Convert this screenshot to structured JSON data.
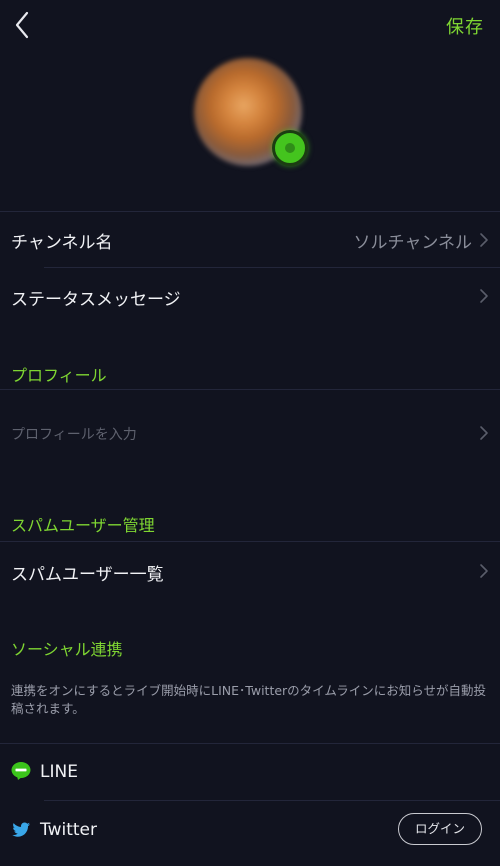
{
  "header": {
    "save_label": "保存"
  },
  "channel": {
    "name_label": "チャンネル名",
    "name_value": "ソルチャンネル",
    "status_label": "ステータスメッセージ"
  },
  "profile": {
    "section_title": "プロフィール",
    "placeholder": "プロフィールを入力"
  },
  "spam": {
    "section_title": "スパムユーザー管理",
    "list_label": "スパムユーザー一覧"
  },
  "social": {
    "section_title": "ソーシャル連携",
    "info": "連携をオンにするとライブ開始時にLINE･Twitterのタイムラインにお知らせが自動投稿されます。",
    "line_label": "LINE",
    "twitter_label": "Twitter",
    "login_label": "ログイン"
  },
  "colors": {
    "background": "#11131f",
    "accent": "#7fd632",
    "divider": "#23263a"
  }
}
